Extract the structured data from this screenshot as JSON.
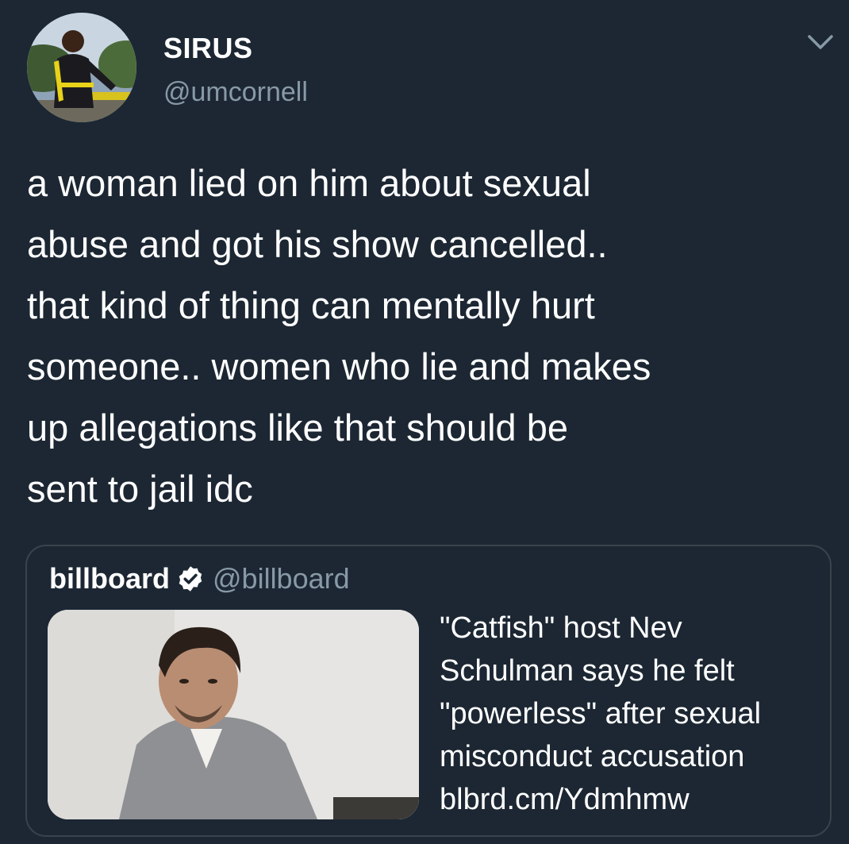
{
  "tweet": {
    "author_name": "SIRUS",
    "author_handle": "@umcornell",
    "text": "a woman lied on him about sexual\nabuse and got his show cancelled..\nthat kind of thing can mentally hurt\nsomeone.. women who lie and makes\nup allegations like that should be\nsent to jail idc"
  },
  "quote": {
    "author_name": "billboard",
    "author_handle": "@billboard",
    "headline": "\"Catfish\" host Nev Schulman says he felt \"powerless\" after sexual misconduct accusation",
    "link": "blbrd.cm/Ydmhmw"
  },
  "icons": {
    "menu": "chevron-down-icon",
    "verified": "verified-badge-icon"
  },
  "colors": {
    "background": "#1c2733",
    "text": "#ffffff",
    "secondary": "#8899a6",
    "border": "#38444d"
  }
}
